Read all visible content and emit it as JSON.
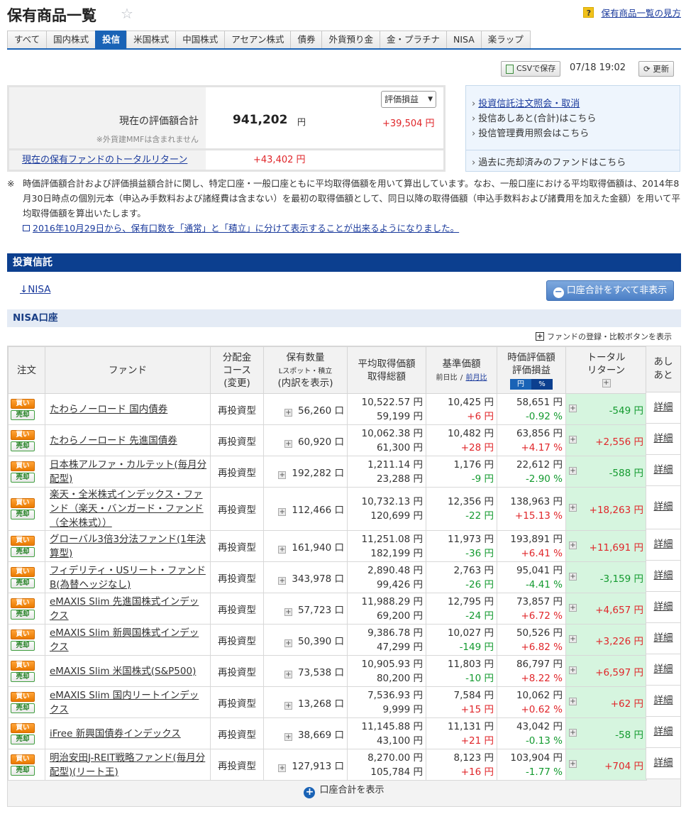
{
  "header": {
    "title": "保有商品一覧",
    "help_label": "保有商品一覧の見方"
  },
  "tabs": [
    {
      "label": "すべて",
      "active": false
    },
    {
      "label": "国内株式",
      "active": false
    },
    {
      "label": "投信",
      "active": true
    },
    {
      "label": "米国株式",
      "active": false
    },
    {
      "label": "中国株式",
      "active": false
    },
    {
      "label": "アセアン株式",
      "active": false
    },
    {
      "label": "債券",
      "active": false
    },
    {
      "label": "外貨預り金",
      "active": false
    },
    {
      "label": "金・プラチナ",
      "active": false
    },
    {
      "label": "NISA",
      "active": false
    },
    {
      "label": "楽ラップ",
      "active": false
    }
  ],
  "toolbar": {
    "csv_label": "CSVで保存",
    "datetime": "07/18 19:02",
    "refresh_label": "更新"
  },
  "summary": {
    "valuation_label": "現在の評価額合計",
    "valuation_note": "※外貨建MMFは含まれません",
    "valuation_value": "941,202",
    "yen": "円",
    "select_value": "評価損益",
    "gain_value": "+39,504 円",
    "total_return_label": "現在の保有ファンドのトータルリターン",
    "total_return_value": "+43,402 円"
  },
  "links": {
    "order_inquiry": "投資信託注文照会・取消",
    "footprint": "投信あしあと(合計)はこちら",
    "fee_inquiry": "投信管理費用照会はこちら",
    "sold_funds": "過去に売却済みのファンドはこちら"
  },
  "note": {
    "mark": "※",
    "text": "時価評価額合計および評価損益額合計に関し、特定口座・一般口座ともに平均取得価額を用いて算出しています。なお、一般口座における平均取得価額は、2014年8月30日時点の個別元本（申込み手数料および諸経費は含まない）を最初の取得価額として、同日以降の取得価額（申込手数料および諸費用を加えた金額）を用いて平均取得価額を算出いたします。",
    "link": "2016年10月29日から、保有口数を「通常」と「積立」に分けて表示することが出来るようになりました。"
  },
  "section": {
    "title": "投資信託",
    "nisa_anchor": "↓NISA",
    "hide_totals_label": "口座合計をすべて非表示",
    "account_title": "NISA口座",
    "fund_register_label": "ファンドの登録・比較ボタンを表示"
  },
  "table": {
    "headers": {
      "order": "注文",
      "fund": "ファンド",
      "course_1": "分配金",
      "course_2": "コース",
      "course_3": "(変更)",
      "qty_1": "保有数量",
      "qty_2": "Lスポット・積立",
      "qty_3": "(内訳を表示)",
      "avg_1": "平均取得価額",
      "avg_2": "取得総額",
      "base_1": "基準価額",
      "base_2a": "前日比",
      "base_sep": "/",
      "base_2b": "前月比",
      "val_1": "時価評価額",
      "val_2": "評価損益",
      "unit_yen": "円",
      "unit_pct": "%",
      "ret_1": "トータル",
      "ret_2": "リターン",
      "foot_1": "あし",
      "foot_2": "あと"
    },
    "buy_label": "買い",
    "sell_label": "売却",
    "detail_label": "詳細",
    "rows": [
      {
        "fund": "たわらノーロード 国内債券",
        "course": "再投資型",
        "qty": "56,260 口",
        "avg": "10,522.57 円",
        "cost": "59,199 円",
        "base": "10,425 円",
        "diff": "+6 円",
        "diff_sign": "pos",
        "val": "58,651 円",
        "gain": "-0.92 %",
        "gain_sign": "neg",
        "ret": "-549 円",
        "ret_sign": "neg"
      },
      {
        "fund": "たわらノーロード 先進国債券",
        "course": "再投資型",
        "qty": "60,920 口",
        "avg": "10,062.38 円",
        "cost": "61,300 円",
        "base": "10,482 円",
        "diff": "+28 円",
        "diff_sign": "pos",
        "val": "63,856 円",
        "gain": "+4.17 %",
        "gain_sign": "pos",
        "ret": "+2,556 円",
        "ret_sign": "pos"
      },
      {
        "fund": "日本株アルファ・カルテット(毎月分配型)",
        "course": "再投資型",
        "qty": "192,282 口",
        "avg": "1,211.14 円",
        "cost": "23,288 円",
        "base": "1,176 円",
        "diff": "-9 円",
        "diff_sign": "neg",
        "val": "22,612 円",
        "gain": "-2.90 %",
        "gain_sign": "neg",
        "ret": "-588 円",
        "ret_sign": "neg"
      },
      {
        "fund": "楽天・全米株式インデックス・ファンド（楽天・バンガード・ファンド（全米株式））",
        "course": "再投資型",
        "qty": "112,466 口",
        "avg": "10,732.13 円",
        "cost": "120,699 円",
        "base": "12,356 円",
        "diff": "-22 円",
        "diff_sign": "neg",
        "val": "138,963 円",
        "gain": "+15.13 %",
        "gain_sign": "pos",
        "ret": "+18,263 円",
        "ret_sign": "pos"
      },
      {
        "fund": "グローバル3倍3分法ファンド(1年決算型)",
        "course": "再投資型",
        "qty": "161,940 口",
        "avg": "11,251.08 円",
        "cost": "182,199 円",
        "base": "11,973 円",
        "diff": "-36 円",
        "diff_sign": "neg",
        "val": "193,891 円",
        "gain": "+6.41 %",
        "gain_sign": "pos",
        "ret": "+11,691 円",
        "ret_sign": "pos"
      },
      {
        "fund": "フィデリティ・USリート・ファンドB(為替ヘッジなし)",
        "course": "再投資型",
        "qty": "343,978 口",
        "avg": "2,890.48 円",
        "cost": "99,426 円",
        "base": "2,763 円",
        "diff": "-26 円",
        "diff_sign": "neg",
        "val": "95,041 円",
        "gain": "-4.41 %",
        "gain_sign": "neg",
        "ret": "-3,159 円",
        "ret_sign": "neg"
      },
      {
        "fund": "eMAXIS Slim 先進国株式インデックス",
        "course": "再投資型",
        "qty": "57,723 口",
        "avg": "11,988.29 円",
        "cost": "69,200 円",
        "base": "12,795 円",
        "diff": "-24 円",
        "diff_sign": "neg",
        "val": "73,857 円",
        "gain": "+6.72 %",
        "gain_sign": "pos",
        "ret": "+4,657 円",
        "ret_sign": "pos"
      },
      {
        "fund": "eMAXIS Slim 新興国株式インデックス",
        "course": "再投資型",
        "qty": "50,390 口",
        "avg": "9,386.78 円",
        "cost": "47,299 円",
        "base": "10,027 円",
        "diff": "-149 円",
        "diff_sign": "neg",
        "val": "50,526 円",
        "gain": "+6.82 %",
        "gain_sign": "pos",
        "ret": "+3,226 円",
        "ret_sign": "pos"
      },
      {
        "fund": "eMAXIS Slim 米国株式(S&P500)",
        "course": "再投資型",
        "qty": "73,538 口",
        "avg": "10,905.93 円",
        "cost": "80,200 円",
        "base": "11,803 円",
        "diff": "-10 円",
        "diff_sign": "neg",
        "val": "86,797 円",
        "gain": "+8.22 %",
        "gain_sign": "pos",
        "ret": "+6,597 円",
        "ret_sign": "pos"
      },
      {
        "fund": "eMAXIS Slim 国内リートインデックス",
        "course": "再投資型",
        "qty": "13,268 口",
        "avg": "7,536.93 円",
        "cost": "9,999 円",
        "base": "7,584 円",
        "diff": "+15 円",
        "diff_sign": "pos",
        "val": "10,062 円",
        "gain": "+0.62 %",
        "gain_sign": "pos",
        "ret": "+62 円",
        "ret_sign": "pos"
      },
      {
        "fund": "iFree 新興国債券インデックス",
        "course": "再投資型",
        "qty": "38,669 口",
        "avg": "11,145.88 円",
        "cost": "43,100 円",
        "base": "11,131 円",
        "diff": "+21 円",
        "diff_sign": "pos",
        "val": "43,042 円",
        "gain": "-0.13 %",
        "gain_sign": "neg",
        "ret": "-58 円",
        "ret_sign": "neg"
      },
      {
        "fund": "明治安田J-REIT戦略ファンド(毎月分配型)(リート王)",
        "course": "再投資型",
        "qty": "127,913 口",
        "avg": "8,270.00 円",
        "cost": "105,784 円",
        "base": "8,123 円",
        "diff": "+16 円",
        "diff_sign": "pos",
        "val": "103,904 円",
        "gain": "-1.77 %",
        "gain_sign": "neg",
        "ret": "+704 円",
        "ret_sign": "pos"
      }
    ],
    "show_total_label": "口座合計を表示"
  }
}
